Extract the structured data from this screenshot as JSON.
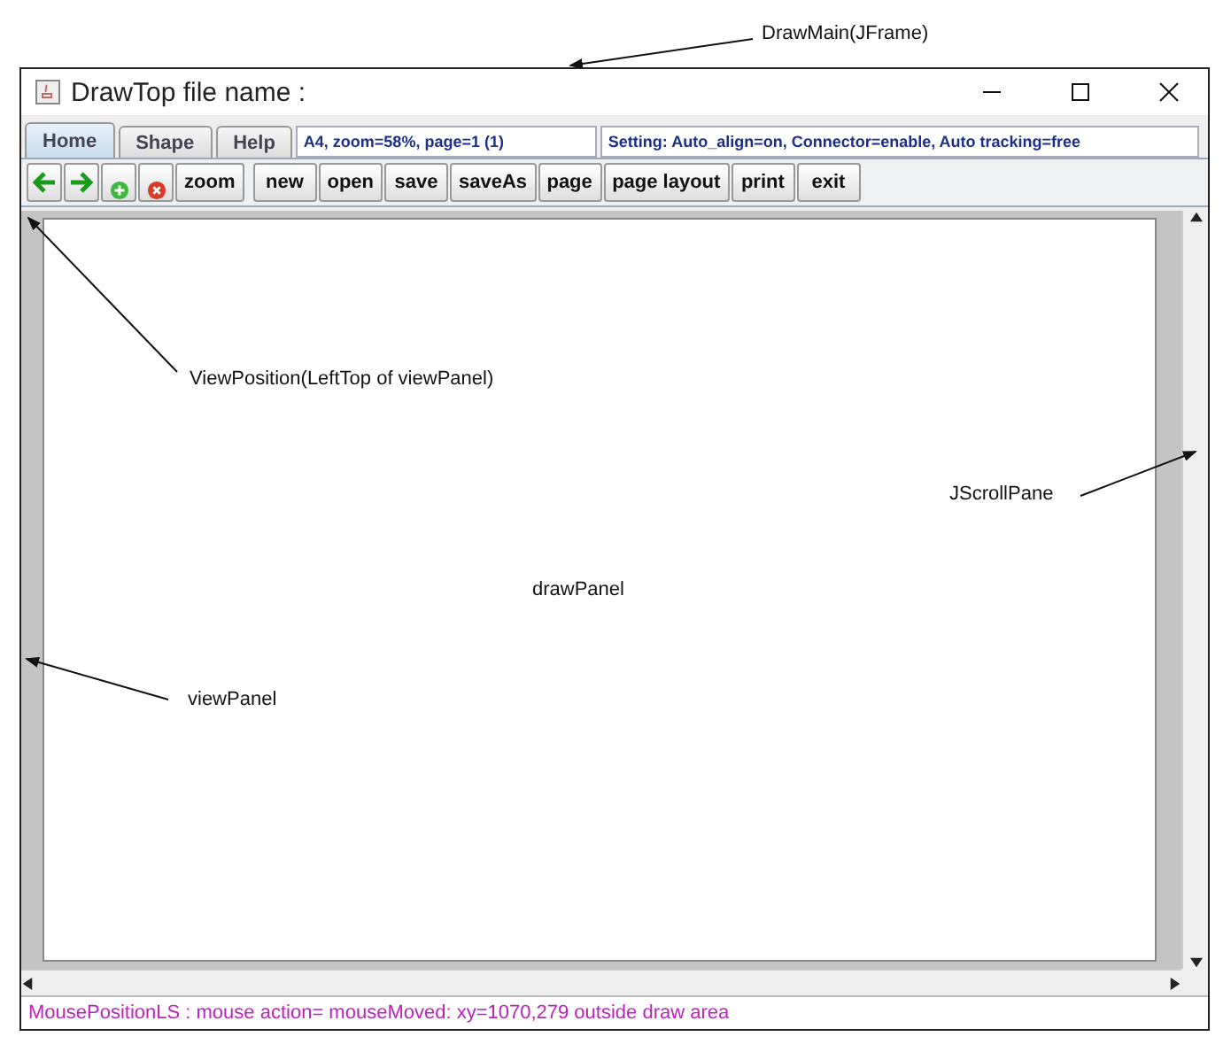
{
  "window": {
    "title": "DrawTop file name :"
  },
  "tabs": [
    {
      "label": "Home",
      "selected": true
    },
    {
      "label": "Shape",
      "selected": false
    },
    {
      "label": "Help",
      "selected": false
    }
  ],
  "info_field": "A4, zoom=58%, page=1 (1)",
  "settings_field": "Setting: Auto_align=on, Connector=enable, Auto tracking=free",
  "toolbar": [
    {
      "kind": "back"
    },
    {
      "kind": "forward"
    },
    {
      "kind": "add"
    },
    {
      "kind": "remove"
    },
    {
      "kind": "text",
      "label": "zoom"
    }
  ],
  "buttons": [
    "new",
    "open",
    "save",
    "saveAs",
    "page",
    "page layout",
    "print",
    "exit"
  ],
  "canvas_label": "drawPanel",
  "status_bar": "MousePositionLS :  mouse action= mouseMoved:   xy=1070,279 outside draw area",
  "annotations": [
    {
      "text": "DrawMain(JFrame)",
      "kind": "top"
    },
    {
      "text": "ViewPosition(LeftTop of viewPanel)",
      "kind": "viewpos"
    },
    {
      "text": "JScrollPane",
      "kind": "scroll"
    },
    {
      "text": "viewPanel",
      "kind": "viewpanel"
    }
  ]
}
